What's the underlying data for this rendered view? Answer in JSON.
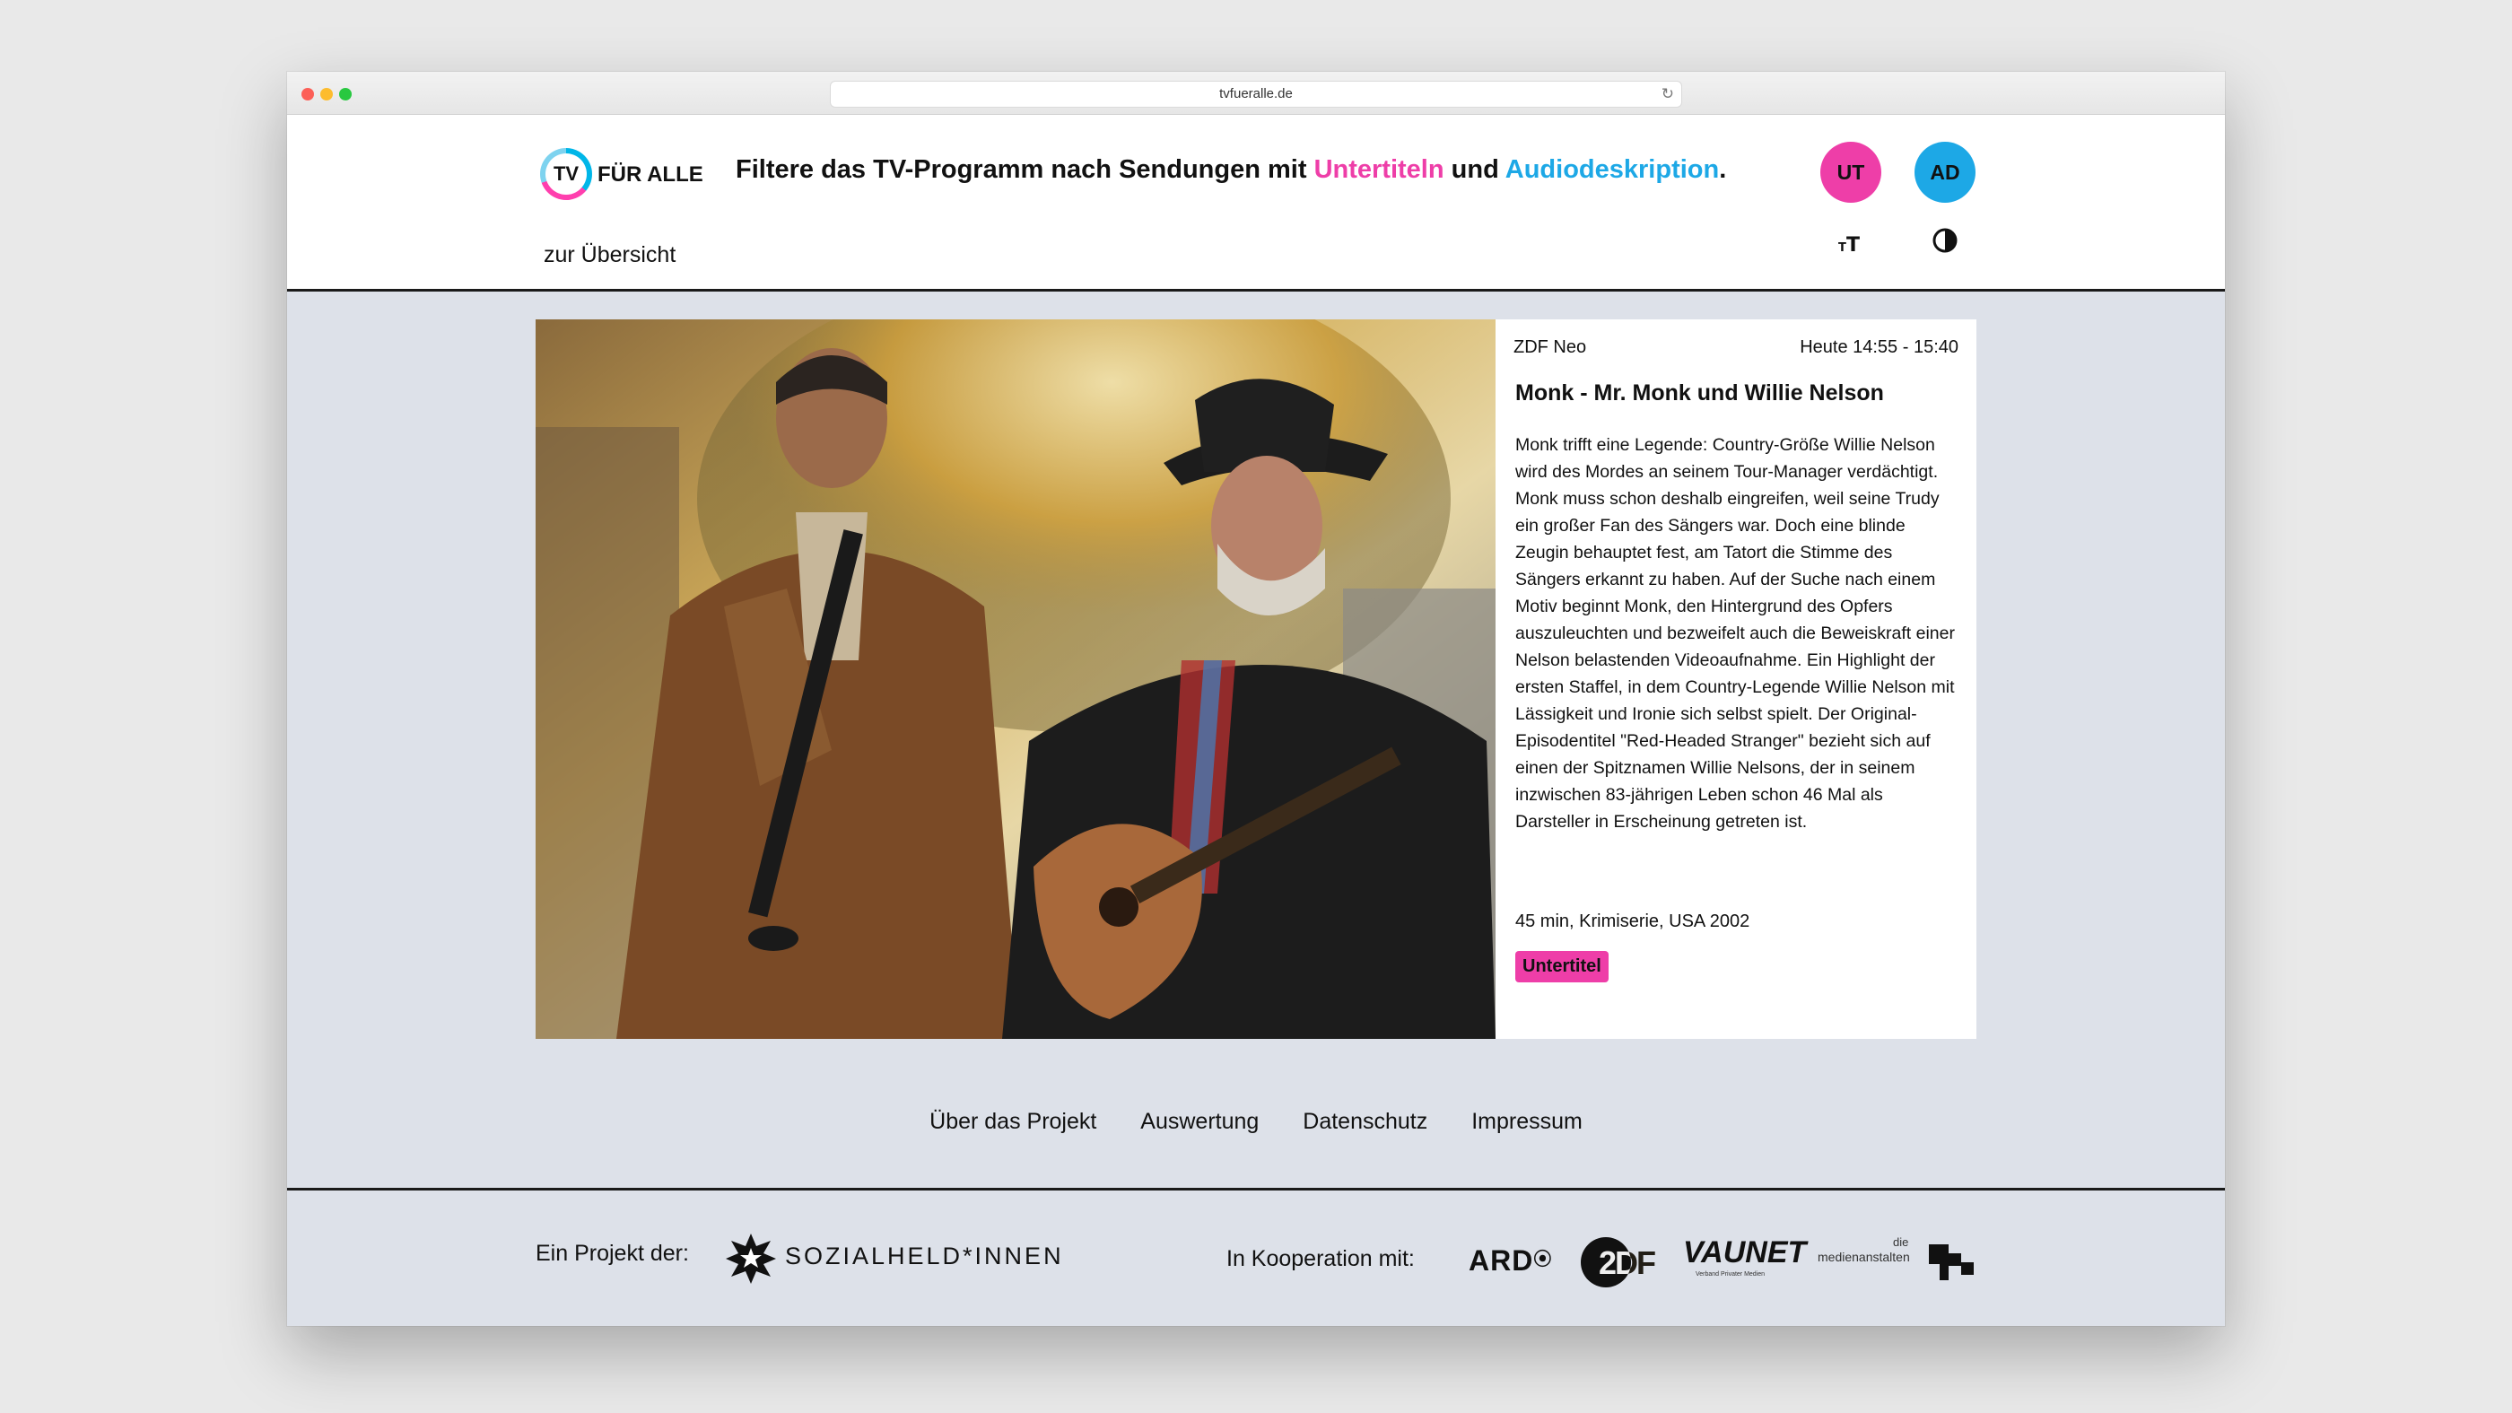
{
  "browser": {
    "url": "tvfueralle.de"
  },
  "header": {
    "logo_tv": "TV",
    "logo_text": "FÜR ALLE",
    "tagline_prefix": "Filtere das TV-Programm nach Sendungen mit ",
    "tagline_ut": "Untertiteln",
    "tagline_mid": " und ",
    "tagline_ad": "Audiodeskription",
    "tagline_suffix": ".",
    "btn_ut": "UT",
    "btn_ad": "AD",
    "back_link": "zur Übersicht"
  },
  "program": {
    "channel": "ZDF Neo",
    "time": "Heute 14:55 - 15:40",
    "title": "Monk - Mr. Monk und Willie Nelson",
    "description": "Monk trifft eine Legende: Country-Größe Willie Nelson wird des Mordes an seinem Tour-Manager verdächtigt. Monk muss schon deshalb eingreifen, weil seine Trudy ein großer Fan des Sängers war. Doch eine blinde Zeugin behauptet fest, am Tatort die Stimme des Sängers erkannt zu haben. Auf der Suche nach einem Motiv beginnt Monk, den Hintergrund des Opfers auszuleuchten und bezweifelt auch die Beweiskraft einer Nelson belastenden Videoaufnahme. Ein Highlight der ersten Staffel, in dem Country-Legende Willie Nelson mit Lässigkeit und Ironie sich selbst spielt. Der Original-Episodentitel \"Red-Headed Stranger\" bezieht sich auf einen der Spitznamen Willie Nelsons, der in seinem inzwischen 83-jährigen Leben schon 46 Mal als Darsteller in Erscheinung getreten ist.",
    "meta": "45 min, Krimiserie, USA 2002",
    "badge": "Untertitel"
  },
  "footer_links": [
    "Über das Projekt",
    "Auswertung",
    "Datenschutz",
    "Impressum"
  ],
  "footer": {
    "project_label": "Ein Projekt der:",
    "project_name": "SOZIALHELD*INNEN",
    "coop_label": "In Kooperation mit:",
    "partners": {
      "ard": "ARD",
      "zdf": "2DF",
      "vaunet": "VAUNET",
      "vaunet_sub": "Verband Privater Medien",
      "medien_die": "die",
      "medien_name": "medienanstalten"
    }
  },
  "colors": {
    "subtitle_pink": "#ee3ea8",
    "audio_blue": "#1da8e6",
    "page_bg": "#dde1e9"
  }
}
